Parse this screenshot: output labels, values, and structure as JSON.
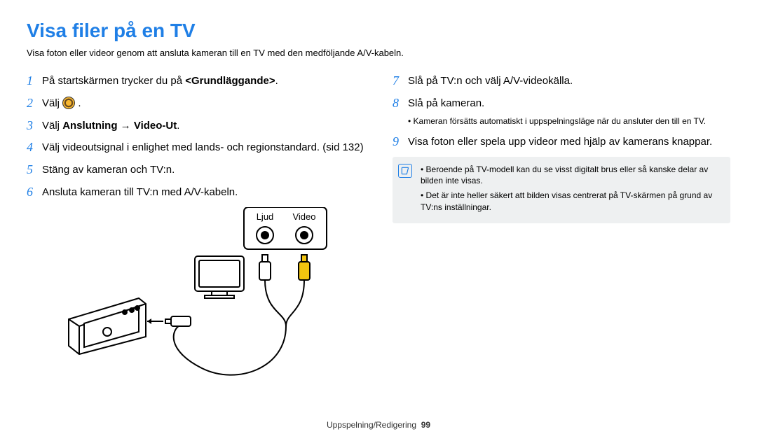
{
  "title": "Visa filer på en TV",
  "intro": "Visa foton eller videor genom att ansluta kameran till en TV med den medföljande A/V-kabeln.",
  "left_steps": [
    {
      "num": "1",
      "pre": "På startskärmen trycker du på ",
      "bold": "<Grundläggande>",
      "post": "."
    },
    {
      "num": "2",
      "pre": "Välj ",
      "icon": true,
      "post": " ."
    },
    {
      "num": "3",
      "pre": "Välj ",
      "bold": "Anslutning → Video-Ut",
      "post": "."
    },
    {
      "num": "4",
      "text": "Välj videoutsignal i enlighet med lands- och regionstandard. (sid 132)"
    },
    {
      "num": "5",
      "text": "Stäng av kameran och TV:n."
    },
    {
      "num": "6",
      "text": "Ansluta kameran till TV:n med A/V-kabeln."
    }
  ],
  "right_steps": [
    {
      "num": "7",
      "text": "Slå på TV:n och välj A/V-videokälla."
    },
    {
      "num": "8",
      "text": "Slå på kameran.",
      "sub": "Kameran försätts automatiskt i uppspelningsläge när du ansluter den till en TV."
    },
    {
      "num": "9",
      "text": "Visa foton eller spela upp videor med hjälp av kamerans knappar."
    }
  ],
  "notes": [
    "Beroende på TV-modell kan du se visst digitalt brus eller så kanske delar av bilden inte visas.",
    "Det är inte heller säkert att bilden visas centrerat på TV-skärmen på grund av TV:ns inställningar."
  ],
  "diagram_labels": {
    "audio": "Ljud",
    "video": "Video"
  },
  "footer": {
    "section": "Uppspelning/Redigering",
    "page": "99"
  }
}
